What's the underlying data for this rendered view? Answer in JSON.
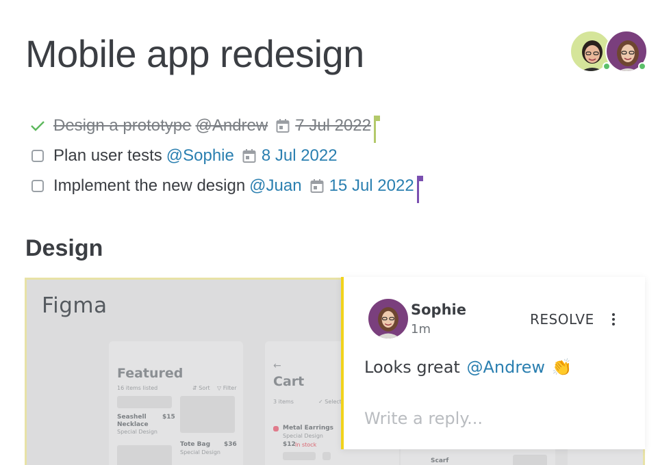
{
  "page": {
    "title": "Mobile app redesign"
  },
  "collaborators": [
    {
      "name": "avatar-user-1",
      "online": true
    },
    {
      "name": "avatar-user-2",
      "online": true
    }
  ],
  "tasks": [
    {
      "text": "Design a prototype",
      "mention": "@Andrew",
      "date": "7 Jul 2022",
      "done": true,
      "flag_color": "#b3c96a"
    },
    {
      "text": "Plan user tests",
      "mention": "@Sophie",
      "date": "8 Jul 2022",
      "done": false,
      "flag_color": null
    },
    {
      "text": "Implement the new design",
      "mention": "@Juan",
      "date": "15 Jul 2022",
      "done": false,
      "flag_color": "#7a4fb0"
    }
  ],
  "section": {
    "title": "Design"
  },
  "figma": {
    "label": "Figma",
    "mock": {
      "featured_title": "Featured",
      "featured_sub": "16 items listed",
      "sort": "⇵ Sort",
      "filter": "▽ Filter",
      "item1_name": "Seashell Necklace",
      "item1_price": "$15",
      "item1_sub": "Special Design",
      "item2_name": "Tote Bag",
      "item2_price": "$36",
      "item2_sub": "Special Design",
      "back": "←",
      "cart_title": "Cart",
      "cart_sub": "3 items",
      "select_all": "✓ Select All",
      "cart_item_name": "Metal Earrings",
      "cart_item_sub": "Special Design",
      "cart_item_price": "$12",
      "cart_item_stock": "In stock",
      "scarf": "Scarf"
    }
  },
  "comment": {
    "author": "Sophie",
    "time": "1m",
    "resolve_label": "RESOLVE",
    "body_text": "Looks great",
    "body_mention": "@Andrew",
    "emoji": "👏",
    "reply_placeholder": "Write a reply..."
  },
  "colors": {
    "accent_link": "#2a7fb0",
    "check_green": "#5cb85c",
    "comment_highlight": "#f1d31c",
    "online": "#5cc06a"
  }
}
